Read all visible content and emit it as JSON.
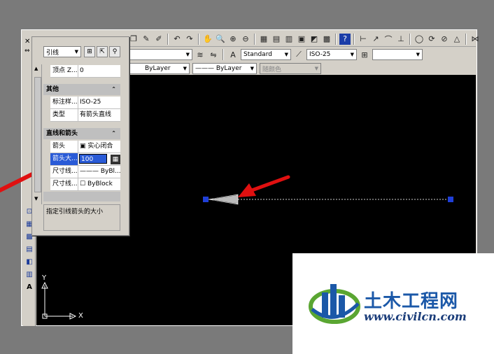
{
  "toolbar": {
    "text_style": "Standard",
    "dim_style": "ISO-25",
    "layer_linetype1": "ByLayer",
    "layer_linetype2": "ByLayer",
    "plot_style": "随颜色"
  },
  "properties": {
    "object_type": "引线",
    "top_rows": [
      {
        "key": "顶点 Z...",
        "value": "0"
      }
    ],
    "sections": [
      {
        "title": "其他",
        "rows": [
          {
            "key": "标注样...",
            "value": "ISO-25"
          },
          {
            "key": "类型",
            "value": "有箭头直线"
          }
        ]
      },
      {
        "title": "直线和箭头",
        "rows": [
          {
            "key": "箭头",
            "value": "实心闭合"
          },
          {
            "key": "箭头大...",
            "value": "100"
          },
          {
            "key": "尺寸线...",
            "value": "ByBl..."
          },
          {
            "key": "尺寸线...",
            "value": "ByBlock"
          }
        ]
      }
    ],
    "description": "指定引线箭头的大小"
  },
  "ucs": {
    "x_label": "X",
    "y_label": "Y"
  },
  "watermark": {
    "title": "土木工程网",
    "url": "www.civilcn.com"
  },
  "colors": {
    "canvas": "#000000",
    "grip": "#1f3fd8",
    "arrow_annotation": "#e01010",
    "watermark_blue": "#1b58a8",
    "watermark_green": "#5aa632"
  }
}
